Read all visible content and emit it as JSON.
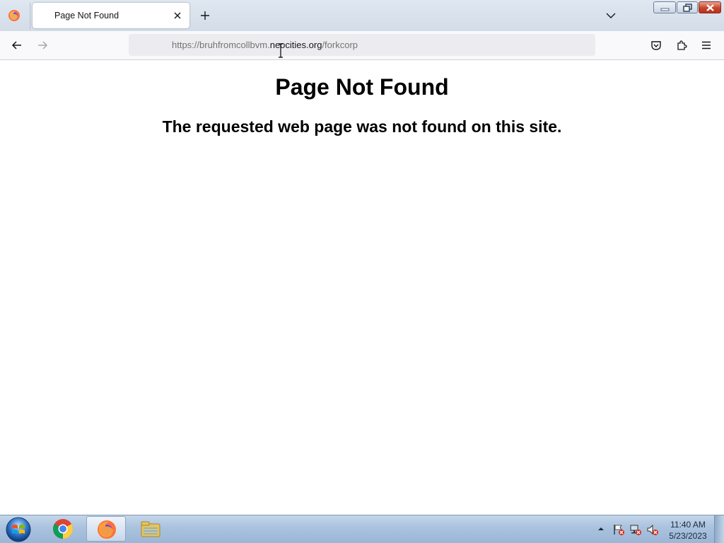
{
  "browser": {
    "tab": {
      "title": "Page Not Found"
    },
    "address_bar": {
      "url_prefix": "https://bruhfromcollbvm.",
      "url_host": "neocities.org",
      "url_path": "/forkcorp"
    }
  },
  "page": {
    "heading": "Page Not Found",
    "message": "The requested web page was not found on this site."
  },
  "taskbar": {
    "clock_time": "11:40 AM",
    "clock_date": "5/23/2023",
    "apps": [
      "chrome-icon",
      "firefox-icon",
      "file-explorer-icon"
    ]
  },
  "colors": {
    "tabstrip_bg": "#d9e1ec",
    "toolbar_bg": "#f9f9fb",
    "urlbar_bg": "#ececf0",
    "taskbar_bg": "#a9c2de"
  }
}
